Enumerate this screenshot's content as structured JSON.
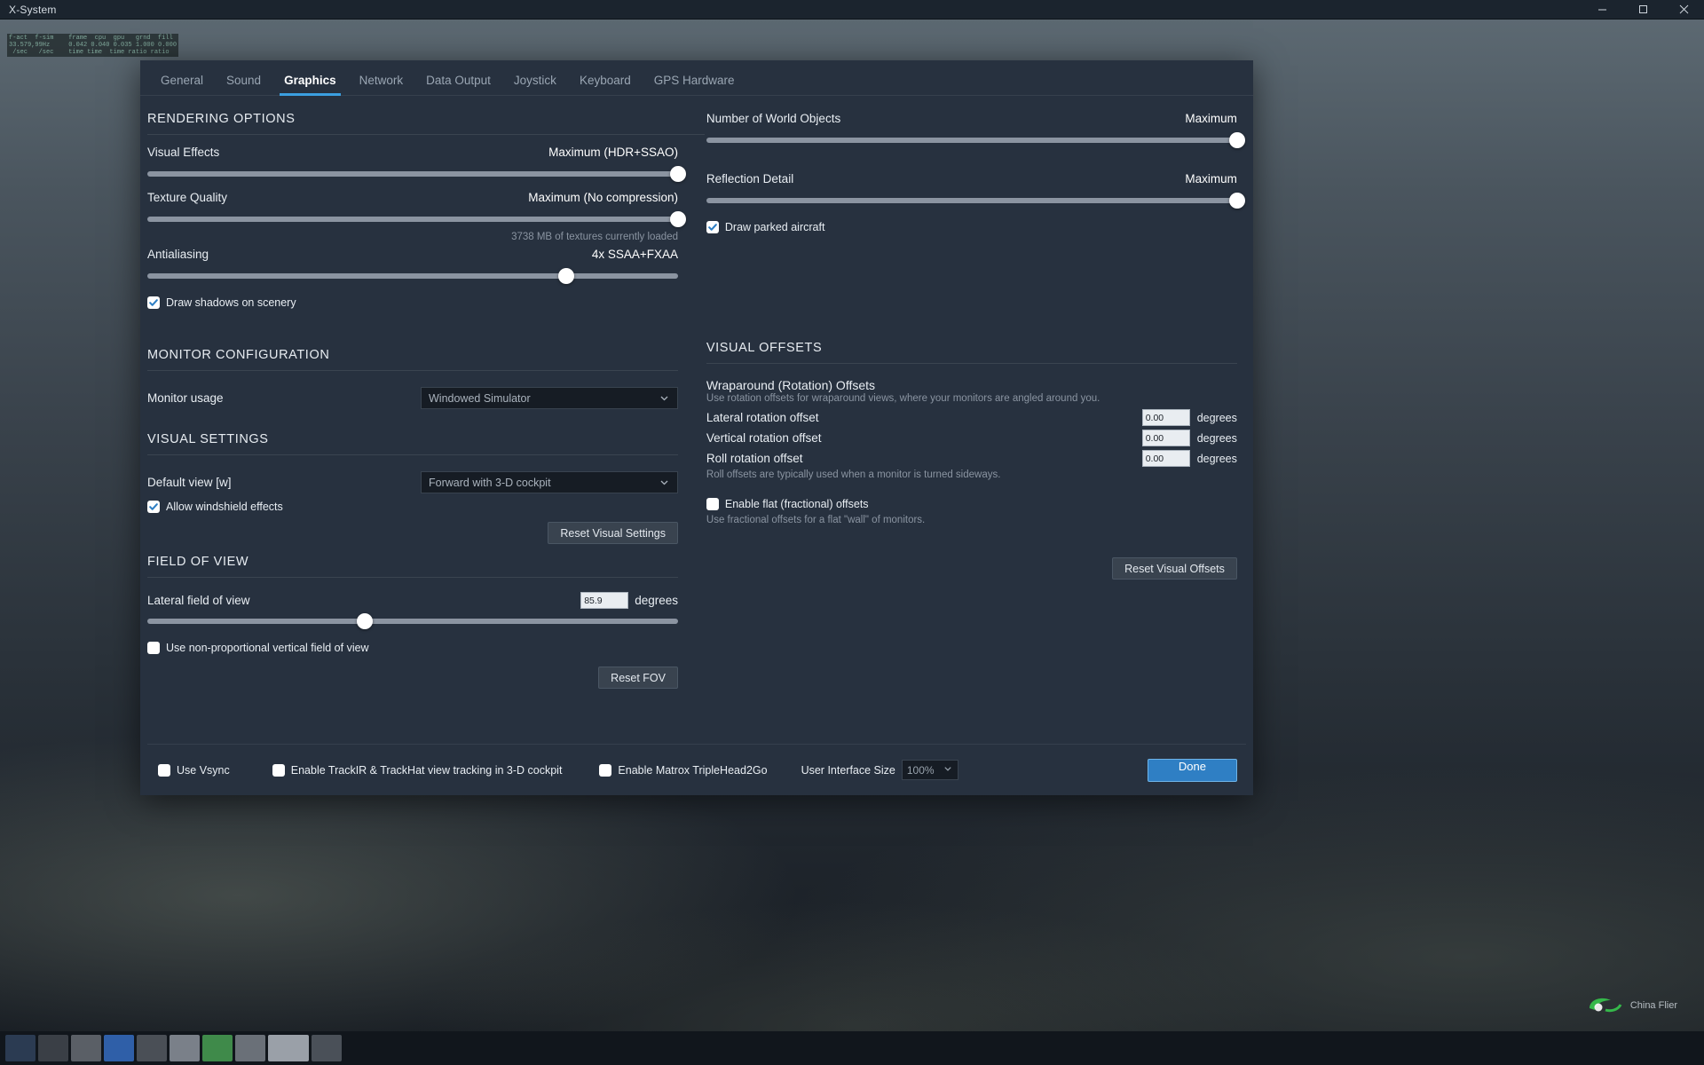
{
  "window": {
    "title": "X-System",
    "minimize_icon": "minimize-icon",
    "maximize_icon": "maximize-icon",
    "close_icon": "close-icon"
  },
  "fps_overlay": "f-act  f-sim    frame  cpu  gpu   grnd  fill\n33.579,99Hz     0.042 0.040 0.035 1.000 0.000\n /sec   /sec    time time  time ratio ratio",
  "tabs": [
    {
      "label": "General",
      "active": false
    },
    {
      "label": "Sound",
      "active": false
    },
    {
      "label": "Graphics",
      "active": true
    },
    {
      "label": "Network",
      "active": false
    },
    {
      "label": "Data Output",
      "active": false
    },
    {
      "label": "Joystick",
      "active": false
    },
    {
      "label": "Keyboard",
      "active": false
    },
    {
      "label": "GPS Hardware",
      "active": false
    }
  ],
  "rendering": {
    "heading": "RENDERING OPTIONS",
    "visual_effects": {
      "label": "Visual Effects",
      "value": "Maximum (HDR+SSAO)",
      "percent": 100
    },
    "texture_quality": {
      "label": "Texture Quality",
      "value": "Maximum (No compression)",
      "percent": 100,
      "note": "3738 MB of textures currently loaded"
    },
    "antialiasing": {
      "label": "Antialiasing",
      "value": "4x SSAA+FXAA",
      "percent": 79
    },
    "draw_shadows": {
      "label": "Draw shadows on scenery",
      "checked": true
    },
    "world_objects": {
      "label": "Number of World Objects",
      "value": "Maximum",
      "percent": 100
    },
    "reflection_detail": {
      "label": "Reflection Detail",
      "value": "Maximum",
      "percent": 100
    },
    "draw_parked_aircraft": {
      "label": "Draw parked aircraft",
      "checked": true
    }
  },
  "monitor": {
    "heading": "MONITOR CONFIGURATION",
    "usage_label": "Monitor usage",
    "usage_value": "Windowed Simulator"
  },
  "visual_settings": {
    "heading": "VISUAL SETTINGS",
    "default_view_label": "Default view [w]",
    "default_view_value": "Forward with 3-D cockpit",
    "windshield_effects": {
      "label": "Allow windshield effects",
      "checked": true
    },
    "reset_button": "Reset Visual Settings"
  },
  "field_of_view": {
    "heading": "FIELD OF VIEW",
    "lateral_label": "Lateral field of view",
    "lateral_value": "85.9",
    "units": "degrees",
    "percent": 41,
    "non_proportional": {
      "label": "Use non-proportional vertical field of view",
      "checked": false
    },
    "reset_button": "Reset FOV"
  },
  "visual_offsets": {
    "heading": "VISUAL OFFSETS",
    "wraparound_title": "Wraparound (Rotation) Offsets",
    "wraparound_desc": "Use rotation offsets for wraparound views, where your monitors are angled around you.",
    "rows": [
      {
        "label": "Lateral rotation offset",
        "value": "0.00",
        "units": "degrees"
      },
      {
        "label": "Vertical rotation offset",
        "value": "0.00",
        "units": "degrees"
      },
      {
        "label": "Roll rotation offset",
        "value": "0.00",
        "units": "degrees"
      }
    ],
    "roll_desc": "Roll offsets are typically used when a monitor is turned sideways.",
    "flat_offsets": {
      "label": "Enable flat (fractional) offsets",
      "checked": false
    },
    "flat_desc": "Use fractional offsets for a flat \"wall\" of monitors.",
    "reset_button": "Reset Visual Offsets"
  },
  "bottom": {
    "vsync": {
      "label": "Use Vsync",
      "checked": false
    },
    "trackir": {
      "label": "Enable TrackIR & TrackHat view tracking in 3-D cockpit",
      "checked": false
    },
    "matrox": {
      "label": "Enable Matrox TripleHead2Go",
      "checked": false
    },
    "ui_size_label": "User Interface Size",
    "ui_size_value": "100%",
    "done_button": "Done"
  },
  "watermark": {
    "text": "China Flier"
  },
  "colors": {
    "accent": "#3b9fe0",
    "panel": "#27313f",
    "primary_button": "#2f7fc4"
  }
}
